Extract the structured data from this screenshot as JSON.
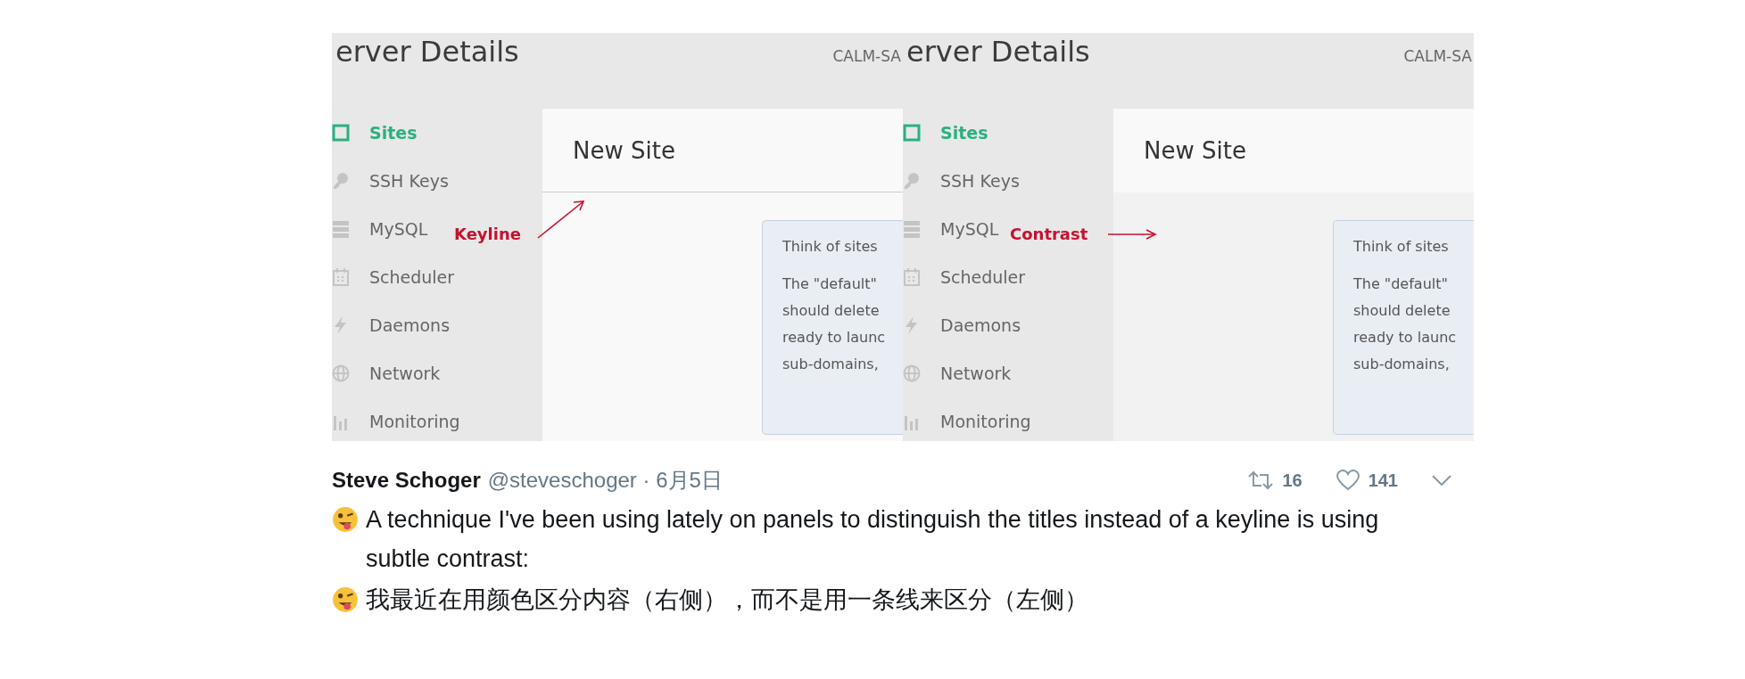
{
  "panels": [
    {
      "kind": "keyline",
      "title": "erver Details",
      "server": "CALM-SA",
      "nav": [
        {
          "label": "Sites",
          "selected": true
        },
        {
          "label": "SSH Keys",
          "selected": false
        },
        {
          "label": "MySQL",
          "selected": false
        },
        {
          "label": "Scheduler",
          "selected": false
        },
        {
          "label": "Daemons",
          "selected": false
        },
        {
          "label": "Network",
          "selected": false
        },
        {
          "label": "Monitoring",
          "selected": false
        }
      ],
      "card": {
        "title": "New Site",
        "info": [
          "Think of sites",
          "The \"default\"",
          "should delete",
          "ready to launc",
          "sub-domains,"
        ]
      },
      "annotation": "Keyline"
    },
    {
      "kind": "contrast",
      "title": "erver Details",
      "server": "CALM-SA",
      "nav": [
        {
          "label": "Sites",
          "selected": true
        },
        {
          "label": "SSH Keys",
          "selected": false
        },
        {
          "label": "MySQL",
          "selected": false
        },
        {
          "label": "Scheduler",
          "selected": false
        },
        {
          "label": "Daemons",
          "selected": false
        },
        {
          "label": "Network",
          "selected": false
        },
        {
          "label": "Monitoring",
          "selected": false
        }
      ],
      "card": {
        "title": "New Site",
        "info": [
          "Think of sites",
          "The \"default\"",
          "should delete",
          "ready to launc",
          "sub-domains,"
        ]
      },
      "annotation": "Contrast"
    }
  ],
  "tweet": {
    "name": "Steve Schoger",
    "meta": "@steveschoger · 6月5日",
    "retweets": "16",
    "likes": "141",
    "paragraphs": [
      "A technique I've been using lately on panels to distinguish the titles instead of a keyline is using subtle contrast:",
      "我最近在用颜色区分内容（右侧），而不是用一条线来区分（左侧）"
    ]
  }
}
